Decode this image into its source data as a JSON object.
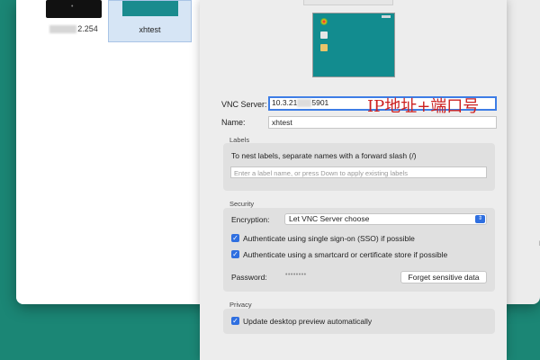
{
  "viewer": {
    "connections": [
      {
        "label_blurred": true,
        "label": "2.254"
      },
      {
        "label": "xhtest"
      }
    ],
    "side_text": "l"
  },
  "sheet": {
    "vnc_server": {
      "label": "VNC Server:",
      "value_prefix": "10.3.21",
      "value_suffix": "5901",
      "annotation": "IP地址+端口号"
    },
    "name": {
      "label": "Name:",
      "value": "xhtest"
    },
    "labels": {
      "title": "Labels",
      "hint": "To nest labels, separate names with a forward slash (/)",
      "placeholder": "Enter a label name, or press Down to apply existing labels"
    },
    "security": {
      "title": "Security",
      "encryption_label": "Encryption:",
      "encryption_value": "Let VNC Server choose",
      "sso_label": "Authenticate using single sign-on (SSO) if possible",
      "sso_checked": true,
      "smartcard_label": "Authenticate using a smartcard or certificate store if possible",
      "smartcard_checked": true,
      "password_label": "Password:",
      "password_dots": "••••••••",
      "forget_button": "Forget sensitive data"
    },
    "privacy": {
      "title": "Privacy",
      "preview_label": "Update desktop preview automatically",
      "preview_checked": true
    }
  },
  "colors": {
    "desktop": "#1b8675",
    "accent": "#2f6fe0",
    "annotation": "#cc2020"
  }
}
